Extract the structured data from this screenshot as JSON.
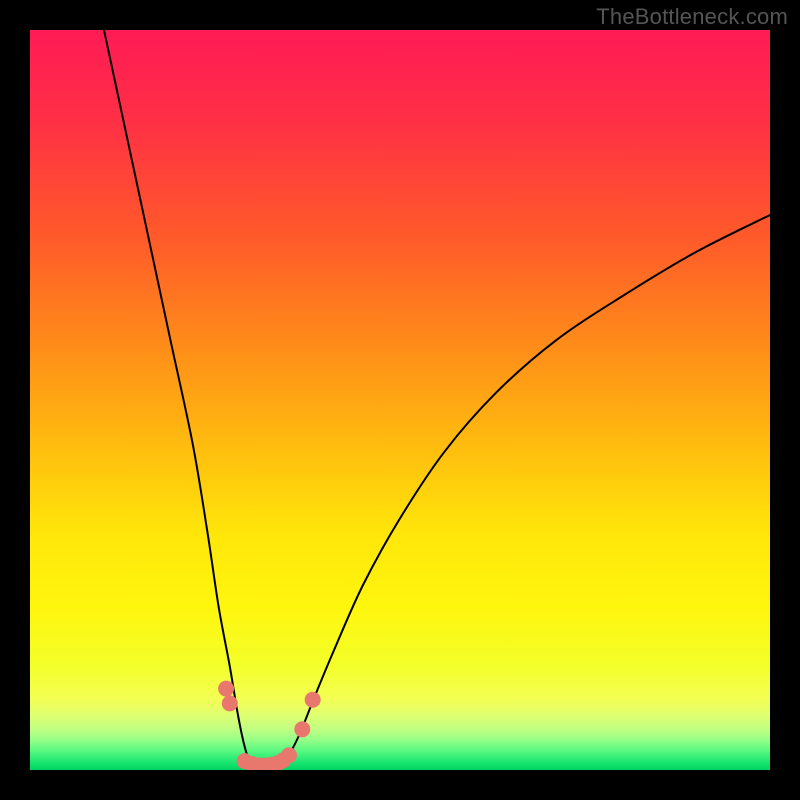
{
  "watermark": "TheBottleneck.com",
  "chart_data": {
    "type": "line",
    "title": "",
    "xlabel": "",
    "ylabel": "",
    "x_range": [
      0,
      100
    ],
    "y_range": [
      0,
      100
    ],
    "series": [
      {
        "name": "bottleneck-curve-left",
        "x": [
          10,
          13,
          16,
          19,
          22,
          24,
          25.5,
          27,
          28,
          28.8,
          29.5,
          30
        ],
        "y": [
          100,
          86,
          72,
          58,
          44,
          32,
          22,
          14,
          8,
          4,
          1.5,
          0.5
        ]
      },
      {
        "name": "bottleneck-curve-right",
        "x": [
          34,
          35,
          36.5,
          38.5,
          41,
          45,
          50,
          56,
          63,
          71,
          80,
          90,
          100
        ],
        "y": [
          0.5,
          2,
          5,
          10,
          16,
          25,
          34,
          43,
          51,
          58,
          64,
          70,
          75
        ]
      }
    ],
    "markers": {
      "name": "highlight-points",
      "color": "#e8786d",
      "points": [
        {
          "x": 26.5,
          "y": 11
        },
        {
          "x": 27.0,
          "y": 9
        },
        {
          "x": 29.0,
          "y": 1.2
        },
        {
          "x": 30.0,
          "y": 0.8
        },
        {
          "x": 31.0,
          "y": 0.6
        },
        {
          "x": 31.8,
          "y": 0.6
        },
        {
          "x": 32.6,
          "y": 0.7
        },
        {
          "x": 33.4,
          "y": 0.9
        },
        {
          "x": 34.2,
          "y": 1.3
        },
        {
          "x": 35.0,
          "y": 2.0
        },
        {
          "x": 36.8,
          "y": 5.5
        },
        {
          "x": 38.2,
          "y": 9.5
        }
      ]
    },
    "gradient_stops": [
      {
        "offset": 0.0,
        "color": "#ff1b55"
      },
      {
        "offset": 0.12,
        "color": "#ff2f46"
      },
      {
        "offset": 0.28,
        "color": "#ff5a2a"
      },
      {
        "offset": 0.42,
        "color": "#ff8a1a"
      },
      {
        "offset": 0.55,
        "color": "#ffb80f"
      },
      {
        "offset": 0.68,
        "color": "#ffe60a"
      },
      {
        "offset": 0.78,
        "color": "#fff60e"
      },
      {
        "offset": 0.86,
        "color": "#f3ff2a"
      },
      {
        "offset": 0.905,
        "color": "#f3ff55"
      },
      {
        "offset": 0.925,
        "color": "#e0ff70"
      },
      {
        "offset": 0.945,
        "color": "#c0ff82"
      },
      {
        "offset": 0.96,
        "color": "#93ff88"
      },
      {
        "offset": 0.975,
        "color": "#55f77f"
      },
      {
        "offset": 0.99,
        "color": "#18e56f"
      },
      {
        "offset": 1.0,
        "color": "#00d264"
      }
    ]
  }
}
